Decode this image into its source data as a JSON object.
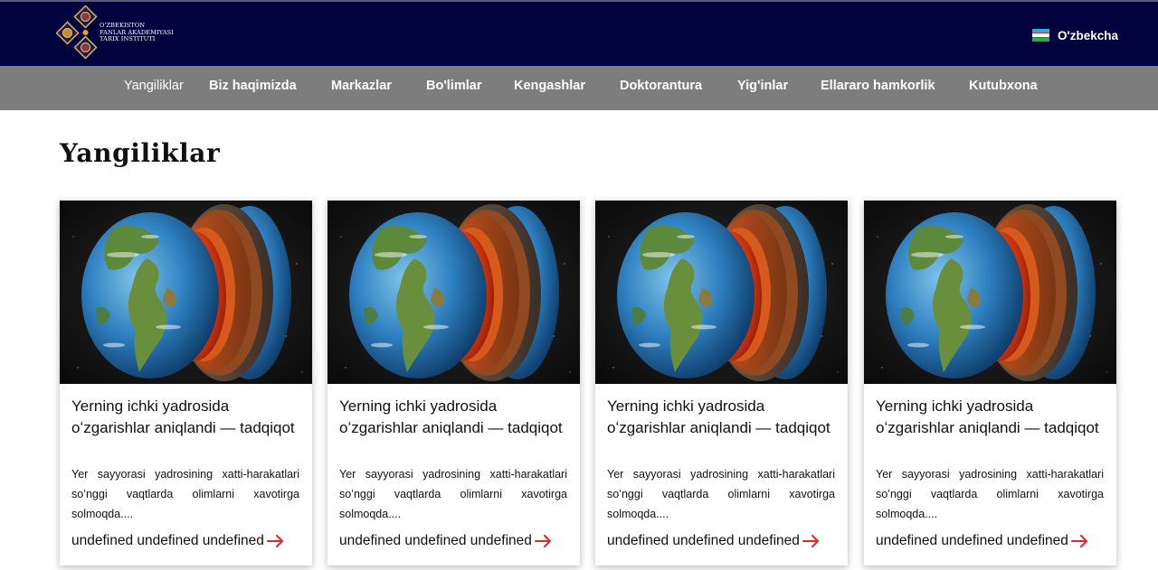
{
  "header": {
    "logo": {
      "line1": "O'ZBEKISTON",
      "line2": "FANLAR AKADEMIYASI",
      "line3": "TARIX INSTITUTI",
      "emblem_icon": "ornamental-emblem-icon"
    },
    "language": {
      "label": "O'zbekcha",
      "flag_icon": "uzbekistan-flag-icon"
    },
    "colors": {
      "background": "#02023f"
    }
  },
  "nav": {
    "colors": {
      "background": "#7d7d7d",
      "text": "#ffffff"
    },
    "items": [
      {
        "label": "Yangiliklar"
      },
      {
        "label": "Biz haqimizda"
      },
      {
        "label": "Markazlar"
      },
      {
        "label": "Bo'limlar"
      },
      {
        "label": "Kengashlar"
      },
      {
        "label": "Doktorantura"
      },
      {
        "label": "Yig'inlar"
      },
      {
        "label": "Ellararo hamkorlik"
      },
      {
        "label": "Kutubxona"
      }
    ]
  },
  "page": {
    "title": "Yangiliklar"
  },
  "news": {
    "accent": "#e8232a",
    "cards": [
      {
        "image_icon": "earth-core-image",
        "title": "Yerning ichki yadrosida oʻzgarishlar aniqlandi — tadqiqot",
        "excerpt": "Yer sayyorasi yadrosining xatti-harakatlari soʻnggi vaqtlarda olimlarni xavotirga solmoqda....",
        "more": "undefined undefined undefined",
        "arrow_icon": "arrow-right-icon"
      },
      {
        "image_icon": "earth-core-image",
        "title": "Yerning ichki yadrosida oʻzgarishlar aniqlandi — tadqiqot",
        "excerpt": "Yer sayyorasi yadrosining xatti-harakatlari soʻnggi vaqtlarda olimlarni xavotirga solmoqda....",
        "more": "undefined undefined undefined",
        "arrow_icon": "arrow-right-icon"
      },
      {
        "image_icon": "earth-core-image",
        "title": "Yerning ichki yadrosida oʻzgarishlar aniqlandi — tadqiqot",
        "excerpt": "Yer sayyorasi yadrosining xatti-harakatlari soʻnggi vaqtlarda olimlarni xavotirga solmoqda....",
        "more": "undefined undefined undefined",
        "arrow_icon": "arrow-right-icon"
      },
      {
        "image_icon": "earth-core-image",
        "title": "Yerning ichki yadrosida oʻzgarishlar aniqlandi — tadqiqot",
        "excerpt": "Yer sayyorasi yadrosining xatti-harakatlari soʻnggi vaqtlarda olimlarni xavotirga solmoqda....",
        "more": "undefined undefined undefined",
        "arrow_icon": "arrow-right-icon"
      }
    ]
  }
}
